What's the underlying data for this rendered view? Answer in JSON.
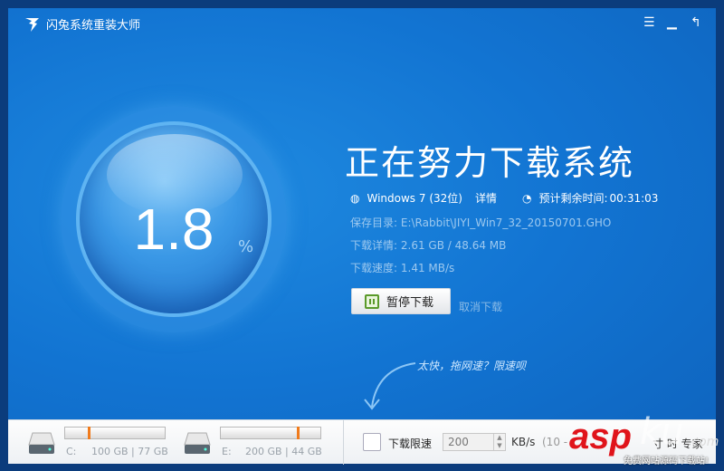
{
  "app": {
    "title": "闪兔系统重装大师"
  },
  "titlebar": {
    "menu_icon": "menu-icon",
    "min_icon": "minimize-icon",
    "back_icon": "return-icon"
  },
  "progress": {
    "percent": "1.8",
    "unit": "%"
  },
  "main": {
    "heading": "正在努力下载系统",
    "os": "Windows 7 (32位)",
    "details_link": "详情",
    "eta_label": "预计剩余时间:",
    "eta": "00:31:03",
    "save_dir_label": "保存目录:",
    "save_dir": "E:\\Rabbit\\JIYI_Win7_32_20150701.GHO",
    "download_detail_label": "下载详情:",
    "download_detail": "2.61 GB / 48.64 MB",
    "speed_label": "下载速度:",
    "speed": "1.41 MB/s",
    "pause_button": "暂停下载",
    "cancel_link": "取消下载",
    "hint": "太快，拖网速？限速呗"
  },
  "bottom": {
    "disks": [
      {
        "label": "C:",
        "sizes": "100 GB | 77 GB",
        "used_fraction": 0.23
      },
      {
        "label": "E:",
        "sizes": "200 GB | 44 GB",
        "used_fraction": 0.78
      }
    ],
    "limit_label": "下载限速",
    "limit_value": "200",
    "limit_unit": "KB/s",
    "limit_range": "(10 -",
    "right_text": "寸 时 专家"
  },
  "watermark": {
    "text": "aspku.com",
    "subtitle": "免费网站源码下载站!"
  }
}
